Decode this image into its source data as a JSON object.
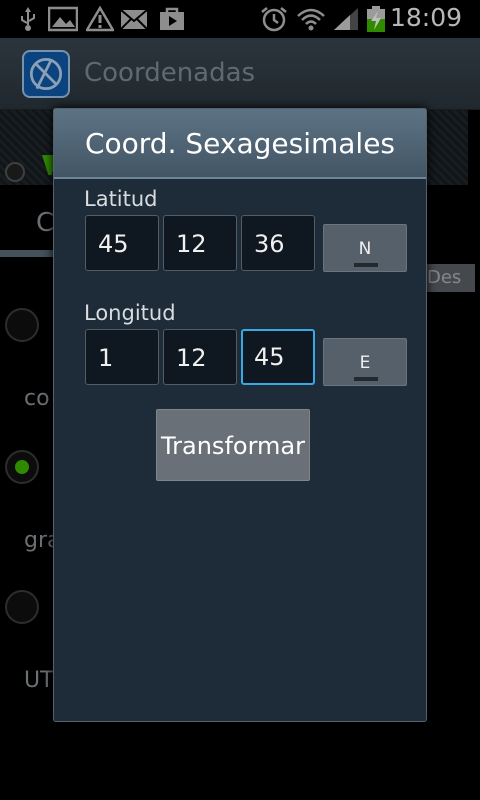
{
  "status_bar": {
    "time": "18:09",
    "icons": [
      "usb-icon",
      "gallery-icon",
      "warning-icon",
      "email-icon",
      "store-icon",
      "alarm-icon",
      "wifi-icon",
      "signal-icon",
      "battery-charging-icon"
    ]
  },
  "action_bar": {
    "title": "Coordenadas"
  },
  "background": {
    "tab_letter": "C",
    "des_label": "Des",
    "option_labels": [
      "co",
      "gra",
      "UT"
    ]
  },
  "dialog": {
    "title": "Coord. Sexagesimales",
    "latitude": {
      "label": "Latitud",
      "degrees": "45",
      "minutes": "12",
      "seconds": "36",
      "hemisphere": "N"
    },
    "longitude": {
      "label": "Longitud",
      "degrees": "1",
      "minutes": "12",
      "seconds": "45",
      "hemisphere": "E"
    },
    "transform_label": "Transformar"
  },
  "colors": {
    "accent_focus": "#38a9e4",
    "radio_selected": "#3fb800",
    "dialog_bg": "#1e2b38"
  }
}
